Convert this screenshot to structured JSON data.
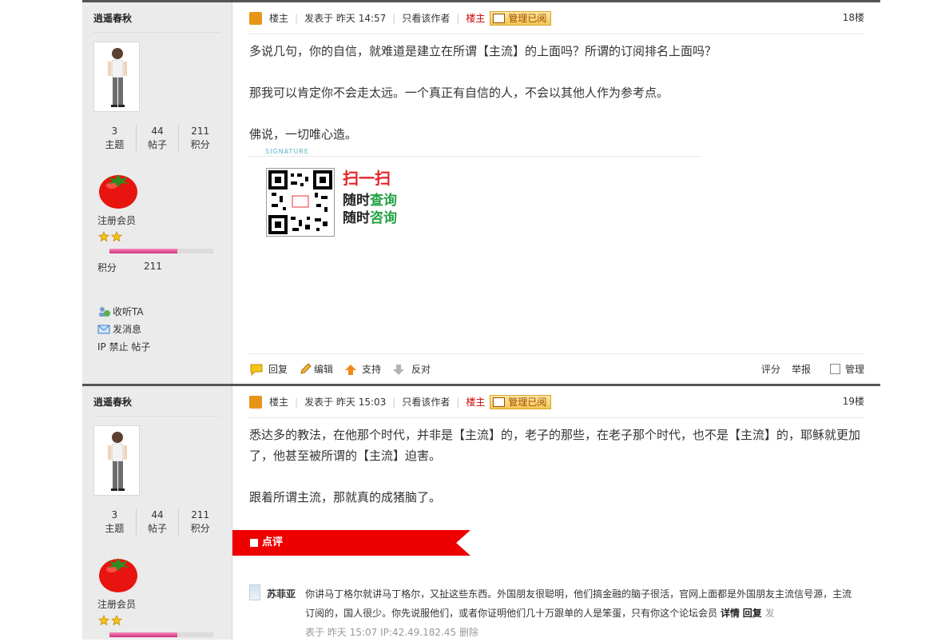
{
  "posts": [
    {
      "author": "逍遥春秋",
      "stats": [
        {
          "value": "3",
          "label": "主题"
        },
        {
          "value": "44",
          "label": "帖子"
        },
        {
          "value": "211",
          "label": "积分"
        }
      ],
      "level": "注册会员",
      "credit_label": "积分",
      "credit_value": "211",
      "progress": 0.65,
      "actions": [
        "收听TA",
        "发消息",
        "IP 禁止 帖子"
      ],
      "header": {
        "role": "楼主",
        "posted": "发表于 昨天 14:57",
        "only_author": "只看该作者",
        "badge": "管理已阅",
        "floor": "18楼"
      },
      "content": [
        "多说几句，你的自信，就难道是建立在所谓【主流】的上面吗？所谓的订阅排名上面吗？",
        "那我可以肯定你不会走太远。一个真正有自信的人，不会以其他人作为参考点。",
        "佛说，一切唯心造。"
      ],
      "signature": "SIGNATURE",
      "qr": {
        "t1": "扫一扫",
        "line1a": "随时",
        "line1b": "查询",
        "line2a": "随时",
        "line2b": "咨询"
      },
      "footer": {
        "reply": "回复",
        "edit": "编辑",
        "support": "支持",
        "oppose": "反对",
        "rate": "评分",
        "report": "举报",
        "manage": "管理"
      }
    },
    {
      "author": "逍遥春秋",
      "stats": [
        {
          "value": "3",
          "label": "主题"
        },
        {
          "value": "44",
          "label": "帖子"
        },
        {
          "value": "211",
          "label": "积分"
        }
      ],
      "level": "注册会员",
      "progress": 0.65,
      "header": {
        "role": "楼主",
        "posted": "发表于 昨天 15:03",
        "only_author": "只看该作者",
        "badge": "管理已阅",
        "floor": "19楼"
      },
      "content": [
        "悉达多的教法，在他那个时代，并非是【主流】的，老子的那些，在老子那个时代，也不是【主流】的，耶稣就更加了，他甚至被所谓的【主流】迫害。",
        "跟着所谓主流，那就真的成猪脑了。"
      ],
      "comment_section_title": "点评",
      "comment": {
        "user": "苏菲亚",
        "text": "你讲马丁格尔就讲马丁格尔，又扯这些东西。外国朋友很聪明，他们搞金融的脑子很活，官网上面都是外国朋友主流信号源，主流订阅的，国人很少。你先说服他们，或者你证明他们几十万跟单的人是笨蛋，只有你这个论坛会员",
        "detail": "详情",
        "reply": "回复",
        "meta1": "发",
        "meta2": "表于 昨天 15:07 IP:42.49.182.45",
        "delete": "删除"
      }
    }
  ],
  "colors": {
    "accent_red": "#e00000",
    "badge": "#f2c655",
    "green": "#24a144"
  }
}
